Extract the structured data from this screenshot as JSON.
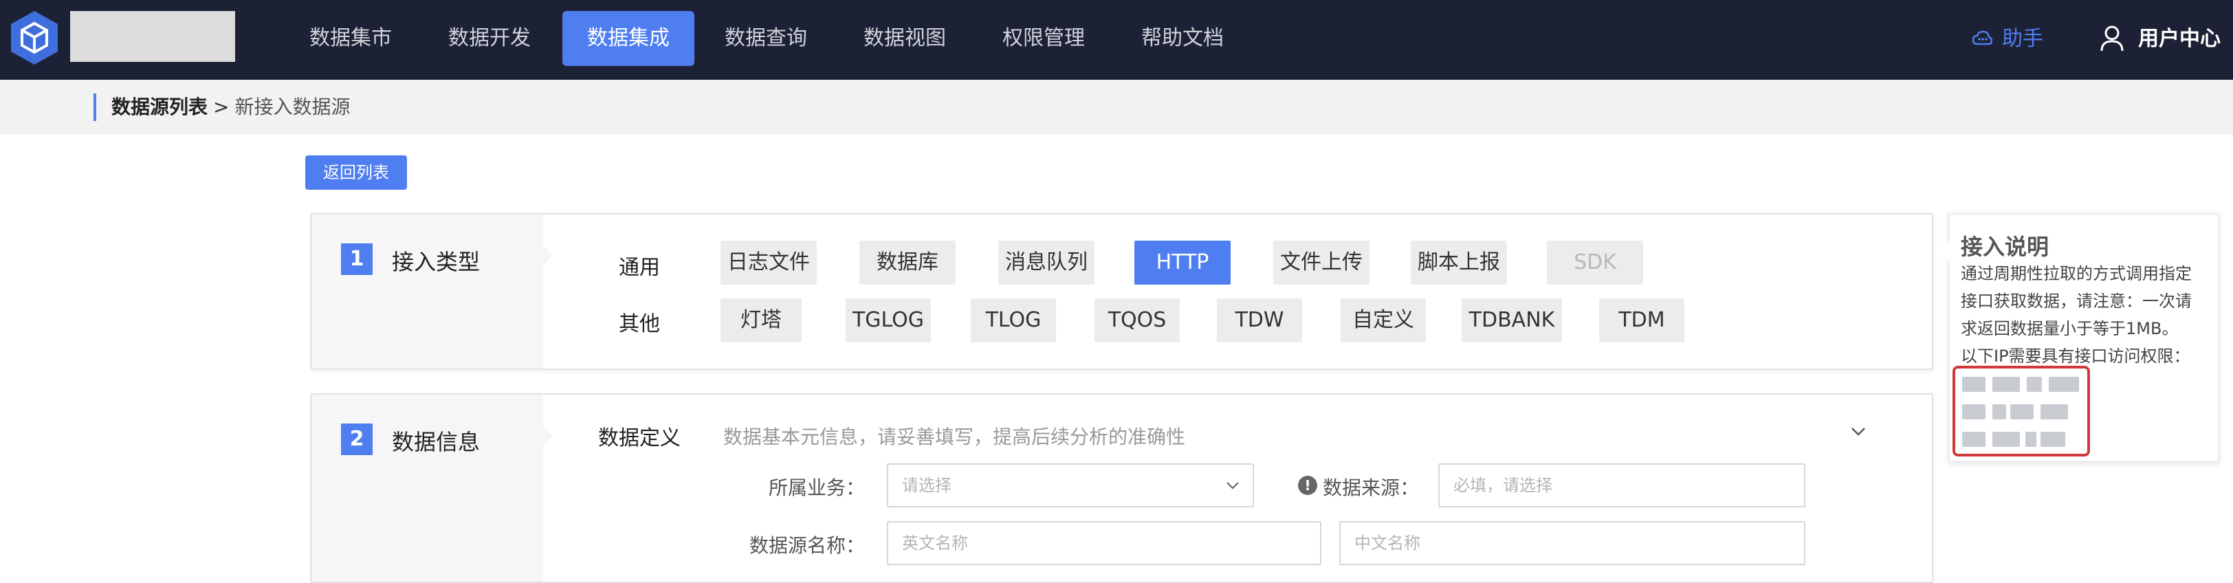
{
  "nav": {
    "items": [
      {
        "label": "数据集市",
        "active": false
      },
      {
        "label": "数据开发",
        "active": false
      },
      {
        "label": "数据集成",
        "active": true
      },
      {
        "label": "数据查询",
        "active": false
      },
      {
        "label": "数据视图",
        "active": false
      },
      {
        "label": "权限管理",
        "active": false
      },
      {
        "label": "帮助文档",
        "active": false
      }
    ],
    "assistant": "助手",
    "user_center": "用户中心",
    "accent": "#4f7ef0",
    "background": "#1c2135"
  },
  "breadcrumb": {
    "parent": "数据源列表",
    "separator": ">",
    "current": "新接入数据源"
  },
  "back_button": "返回列表",
  "step1": {
    "number": "1",
    "title": "接入类型",
    "general_label": "通用",
    "other_label": "其他",
    "general_types": [
      {
        "label": "日志文件",
        "state": "normal"
      },
      {
        "label": "数据库",
        "state": "normal"
      },
      {
        "label": "消息队列",
        "state": "normal"
      },
      {
        "label": "HTTP",
        "state": "selected"
      },
      {
        "label": "文件上传",
        "state": "normal"
      },
      {
        "label": "脚本上报",
        "state": "normal"
      },
      {
        "label": "SDK",
        "state": "disabled"
      }
    ],
    "other_types": [
      {
        "label": "灯塔"
      },
      {
        "label": "TGLOG"
      },
      {
        "label": "TLOG"
      },
      {
        "label": "TQOS"
      },
      {
        "label": "TDW"
      },
      {
        "label": "自定义"
      },
      {
        "label": "TDBANK"
      },
      {
        "label": "TDM"
      }
    ]
  },
  "step2": {
    "number": "2",
    "title": "数据信息",
    "definition_label": "数据定义",
    "definition_hint": "数据基本元信息，请妥善填写，提高后续分析的准确性",
    "business_label": "所属业务：",
    "business_placeholder": "请选择",
    "source_label": "数据来源：",
    "source_placeholder": "必填，请选择",
    "name_label": "数据源名称：",
    "name_en_placeholder": "英文名称",
    "name_cn_placeholder": "中文名称"
  },
  "tip": {
    "title": "接入说明",
    "lines": [
      "通过周期性拉取的方式调用指定",
      "接口获取数据，请注意：一次请",
      "求返回数据量小于等于1MB。",
      "以下IP需要具有接口访问权限："
    ],
    "highlight_color": "#d0393a"
  }
}
